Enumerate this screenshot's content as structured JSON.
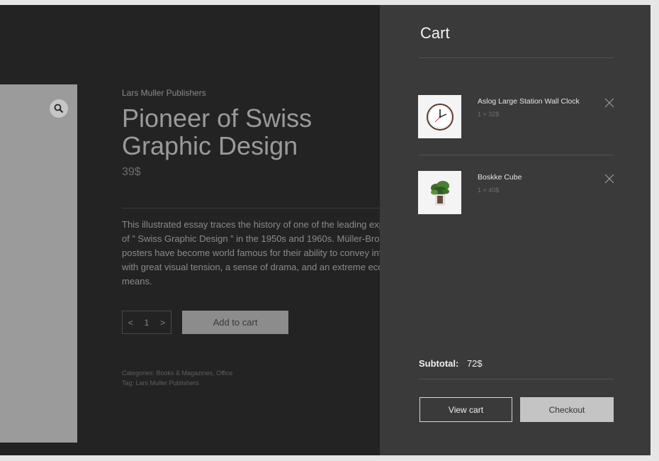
{
  "product": {
    "publisher": "Lars Muller Publishers",
    "title": "Pioneer of Swiss Graphic Design",
    "price": "39$",
    "description": "This illustrated essay traces the history of one of the leading exponents of ” Swiss Graphic Design ” in the 1950s and 1960s. Müller-Brockmann’s posters have become world famous for their ability to convey information with great visual tension, a sense of drama, and an extreme economy of means.",
    "quantity": "1",
    "qty_decrement": "<",
    "qty_increment": ">",
    "add_to_cart_label": "Add to cart",
    "categories_label": "Categories:",
    "categories_value": "Books & Magazines, Office",
    "tag_label": "Tag:",
    "tag_value": "Lars Muller Publishers"
  },
  "icons": {
    "zoom": "magnifier-icon",
    "remove": "close-x-icon",
    "clock": "wall-clock-icon",
    "plant": "potted-plant-icon"
  },
  "cart": {
    "title": "Cart",
    "items": [
      {
        "name": "Aslog Large Station Wall Clock",
        "qty_price": "1 × 32$"
      },
      {
        "name": "Boskke Cube",
        "qty_price": "1 × 40$"
      }
    ],
    "subtotal_label": "Subtotal:",
    "subtotal_value": "72$",
    "view_cart_label": "View cart",
    "checkout_label": "Checkout"
  },
  "colors": {
    "page_bg": "#232323",
    "cart_bg": "#3a3a3a",
    "button_gray": "#8c8c8c",
    "checkout_bg": "#c4c4c4"
  }
}
